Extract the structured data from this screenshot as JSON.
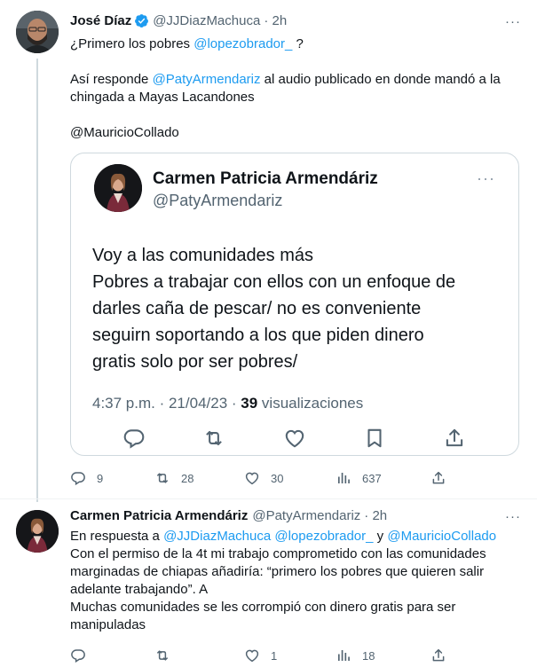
{
  "tweet1": {
    "author_name": "José Díaz",
    "handle": "@JJDiazMachuca",
    "time": "· 2h",
    "more": "···",
    "line1_pre": "¿Primero los pobres ",
    "line1_mention": "@lopezobrador_",
    "line1_post": " ?",
    "line2_pre": "Así responde ",
    "line2_mention": "@PatyArmendariz",
    "line2_post": " al audio publicado en donde mandó a la",
    "line3": "chingada a Mayas Lacandones",
    "line4_mention": "@MauricioCollado",
    "quote": {
      "author_name": "Carmen Patricia Armendáriz",
      "handle": "@PatyArmendariz",
      "more": "···",
      "body_lines": [
        "Voy a las comunidades más",
        "Pobres a trabajar con ellos con un enfoque de",
        "darles caña de pescar/ no es conveniente",
        "seguirn soportando a los que piden dinero",
        "gratis solo por ser pobres/"
      ],
      "meta_time": "4:37 p.m. · 21/04/23 · ",
      "meta_views": "39",
      "meta_views_label": " visualizaciones"
    },
    "stats": {
      "replies": "9",
      "retweets": "28",
      "likes": "30",
      "views": "637"
    }
  },
  "tweet2": {
    "author_name": "Carmen Patricia Armendáriz",
    "handle": "@PatyArmendariz",
    "time": "· 2h",
    "more": "···",
    "reply_prefix": "En respuesta a ",
    "reply_to_1": "@JJDiazMachuca",
    "reply_to_2": "@lopezobrador_",
    "reply_and": " y ",
    "reply_to_3": "@MauricioCollado",
    "lines": [
      "Con el permiso de la 4t mi trabajo comprometido con las comunidades",
      "marginadas de chiapas añadiría: “primero los pobres que quieren salir",
      "adelante trabajando”. A",
      "Muchas comunidades se les corrompió con dinero gratis para ser",
      "manipuladas"
    ],
    "stats": {
      "replies": "",
      "retweets": "",
      "likes": "1",
      "views": "18"
    }
  },
  "colors": {
    "link": "#1d9bf0",
    "muted": "#536471",
    "border": "#cfd9de",
    "verified": "#1d9bf0"
  },
  "icons": [
    "reply-icon",
    "retweet-icon",
    "like-icon",
    "views-icon",
    "bookmark-icon",
    "share-icon",
    "verified-icon",
    "more-icon"
  ]
}
